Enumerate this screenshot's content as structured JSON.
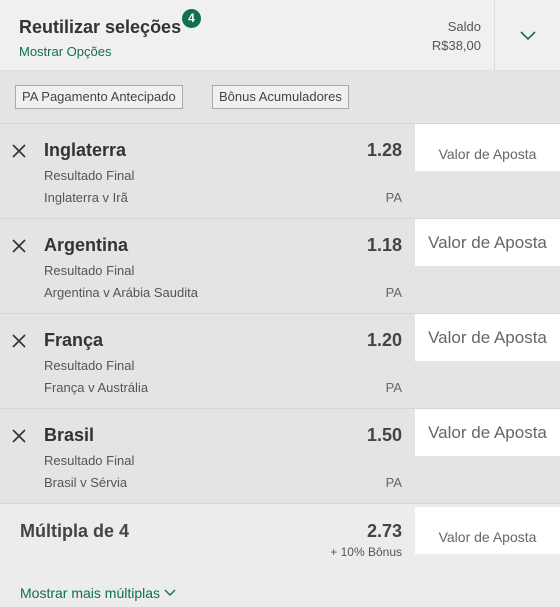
{
  "header": {
    "title": "Reutilizar seleções",
    "badge_count": "4",
    "show_options": "Mostrar Opções",
    "balance_label": "Saldo",
    "balance_value": "R$38,00"
  },
  "tags": [
    {
      "label": "PA  Pagamento Antecipado"
    },
    {
      "label": "Bônus Acumuladores"
    }
  ],
  "selections": [
    {
      "name": "Inglaterra",
      "odds": "1.28",
      "market": "Resultado Final",
      "event": "Inglaterra v Irã",
      "pa": "PA",
      "stake_placeholder": "Valor de Aposta"
    },
    {
      "name": "Argentina",
      "odds": "1.18",
      "market": "Resultado Final",
      "event": "Argentina v Arábia Saudita",
      "pa": "PA",
      "stake_placeholder": "Valor de Aposta"
    },
    {
      "name": "França",
      "odds": "1.20",
      "market": "Resultado Final",
      "event": "França v Austrália",
      "pa": "PA",
      "stake_placeholder": "Valor de Aposta"
    },
    {
      "name": "Brasil",
      "odds": "1.50",
      "market": "Resultado Final",
      "event": "Brasil v Sérvia",
      "pa": "PA",
      "stake_placeholder": "Valor de Aposta"
    }
  ],
  "multiple": {
    "name": "Múltipla de 4",
    "odds": "2.73",
    "bonus": "+ 10% Bônus",
    "stake_placeholder": "Valor de Aposta",
    "more_link": "Mostrar mais múltiplas"
  },
  "colors": {
    "accent": "#126e51",
    "background": "#e4e4e4",
    "stake_background": "#ffffff"
  },
  "icons": {
    "remove": "close-icon",
    "expand": "chevron-down-icon",
    "more": "chevron-down-icon"
  }
}
